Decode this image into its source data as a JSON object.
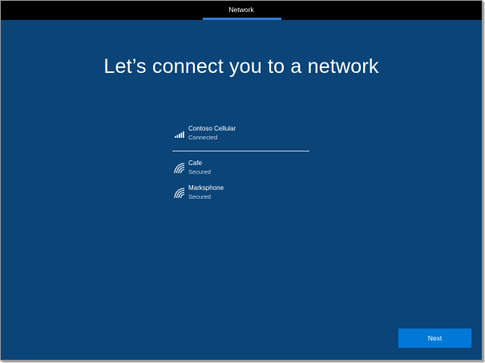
{
  "header": {
    "title": "Network"
  },
  "page": {
    "heading": "Let’s connect you to a network"
  },
  "networks": [
    {
      "name": "Contoso Cellular",
      "status": "Connected",
      "icon": "cellular-signal-icon"
    },
    {
      "name": "Cafe",
      "status": "Secured",
      "icon": "wifi-icon"
    },
    {
      "name": "Marksphone",
      "status": "Secured",
      "icon": "wifi-icon"
    }
  ],
  "footer": {
    "next_label": "Next"
  },
  "colors": {
    "background": "#0a4478",
    "accent": "#0078d7",
    "topbar": "#000000"
  }
}
